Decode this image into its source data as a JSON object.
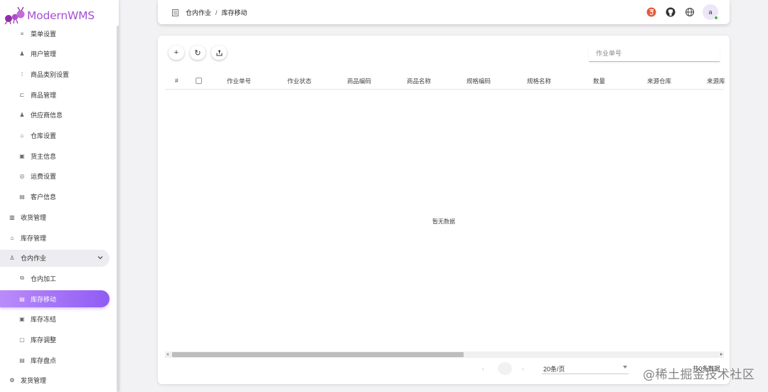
{
  "app": {
    "logo_text": "ModernWMS"
  },
  "sidebar": {
    "items": [
      {
        "label": "菜单设置",
        "icon": "menu-list-icon",
        "level": "sub"
      },
      {
        "label": "用户管理",
        "icon": "user-icon",
        "level": "sub"
      },
      {
        "label": "商品类别设置",
        "icon": "category-grid-icon",
        "level": "sub"
      },
      {
        "label": "商品管理",
        "icon": "cart-icon",
        "level": "sub"
      },
      {
        "label": "供应商信息",
        "icon": "supplier-icon",
        "level": "sub"
      },
      {
        "label": "仓库设置",
        "icon": "warehouse-icon",
        "level": "sub"
      },
      {
        "label": "货主信息",
        "icon": "owner-card-icon",
        "level": "sub"
      },
      {
        "label": "运费设置",
        "icon": "freight-icon",
        "level": "sub"
      },
      {
        "label": "客户信息",
        "icon": "customer-icon",
        "level": "sub"
      },
      {
        "label": "收货管理",
        "icon": "receive-icon",
        "level": "top"
      },
      {
        "label": "库存管理",
        "icon": "stock-icon",
        "level": "top"
      },
      {
        "label": "仓内作业",
        "icon": "worker-icon",
        "level": "group",
        "expanded": true
      },
      {
        "label": "仓内加工",
        "icon": "process-icon",
        "level": "sub"
      },
      {
        "label": "库存移动",
        "icon": "move-doc-icon",
        "level": "sub",
        "active": true
      },
      {
        "label": "库存冻结",
        "icon": "lock-icon",
        "level": "sub"
      },
      {
        "label": "库存调整",
        "icon": "adjust-icon",
        "level": "sub"
      },
      {
        "label": "库存盘点",
        "icon": "count-icon",
        "level": "sub"
      },
      {
        "label": "发货管理",
        "icon": "ship-icon",
        "level": "top"
      }
    ]
  },
  "header": {
    "breadcrumb": [
      "仓内作业",
      "库存移动"
    ],
    "separator": "/",
    "avatar_initial": "a",
    "icons": [
      "html5-icon",
      "github-icon",
      "globe-icon"
    ]
  },
  "toolbar": {
    "add_label": "+",
    "refresh_label": "↻",
    "export_label": "⇪",
    "search_placeholder": "作业单号",
    "search_value": ""
  },
  "table": {
    "columns": [
      "#",
      "作业单号",
      "作业状态",
      "商品编码",
      "商品名称",
      "规格编码",
      "规格名称",
      "数量",
      "来源仓库",
      "来源库"
    ],
    "empty_text": "暂无数据"
  },
  "pagination": {
    "page_size_label": "20条/页",
    "total_label": "共0条数据"
  },
  "watermark": "@稀土掘金技术社区",
  "colors": {
    "accent": "#8f5cf5",
    "logo": "#a54fd6"
  }
}
